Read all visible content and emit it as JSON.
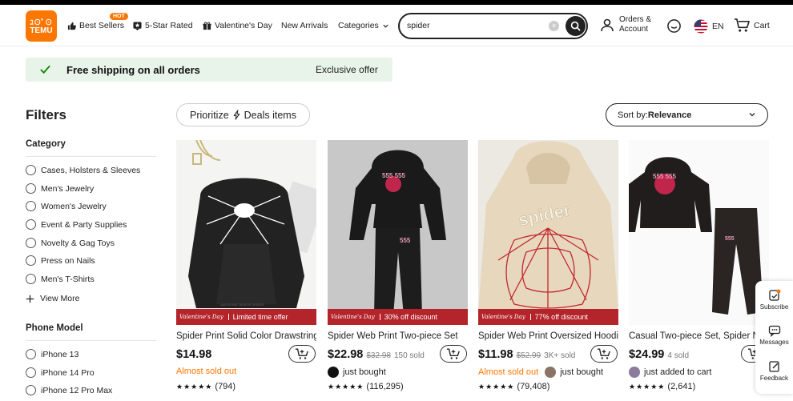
{
  "header": {
    "logo": {
      "line1": "ﾕ⊙ﾟ⊙",
      "line2": "TEMU"
    },
    "nav": {
      "best_sellers": "Best Sellers",
      "hot_badge": "HOT",
      "five_star": "5-Star Rated",
      "valentines": "Valentine's Day",
      "new_arrivals": "New Arrivals",
      "categories": "Categories"
    },
    "search": {
      "value": "spider"
    },
    "account": {
      "line1": "Orders &",
      "line2": "Account"
    },
    "language": "EN",
    "cart": "Cart"
  },
  "promo": {
    "text": "Free shipping on all orders",
    "offer": "Exclusive offer"
  },
  "filters": {
    "title": "Filters",
    "category": {
      "title": "Category",
      "options": [
        "Cases, Holsters & Sleeves",
        "Men's Jewelry",
        "Women's Jewelry",
        "Event & Party Supplies",
        "Novelty & Gag Toys",
        "Press on Nails",
        "Men's T-Shirts"
      ],
      "view_more": "View More"
    },
    "phone_model": {
      "title": "Phone Model",
      "options": [
        "iPhone 13",
        "iPhone 14 Pro",
        "iPhone 12 Pro Max"
      ]
    }
  },
  "toolbar": {
    "prioritize_prefix": "Prioritize",
    "prioritize_label": "Deals items",
    "sort_prefix": "Sort by: ",
    "sort_value": "Relevance"
  },
  "products": [
    {
      "banner_tag": "Valentine's Day",
      "banner": "Limited time offer",
      "title": "Spider Print Solid Color Drawstring Hoodie",
      "price": "$14.98",
      "was": "",
      "sold": "",
      "alert": "Almost sold out",
      "activity": "",
      "rating": "(794)",
      "stars": "★★★★★"
    },
    {
      "banner_tag": "Valentine's Day",
      "banner": "30% off discount",
      "title": "Spider Web Print Two-piece Set",
      "price": "$22.98",
      "was": "$32.98",
      "sold": "150 sold",
      "alert": "",
      "activity": "just bought",
      "rating": "(116,295)",
      "stars": "★★★★★"
    },
    {
      "banner_tag": "Valentine's Day",
      "banner": "77% off discount",
      "title": "Spider Web Print Oversized Hoodie",
      "price": "$11.98",
      "was": "$52.99",
      "sold": "3K+ sold",
      "alert": "Almost sold out",
      "activity": "just bought",
      "rating": "(79,408)",
      "stars": "★★★★★"
    },
    {
      "banner_tag": "",
      "banner": "",
      "title": "Casual Two-piece Set, Spider N",
      "price": "$24.99",
      "was": "",
      "sold": "4 sold",
      "alert": "",
      "activity": "just added to cart",
      "rating": "(2,641)",
      "stars": "★★★★★"
    }
  ],
  "side_widget": {
    "subscribe": "Subscribe",
    "messages": "Messages",
    "feedback": "Feedback"
  },
  "colors": {
    "brand": "#fb7701",
    "promo_bg": "#e8f4e9",
    "banner": "#b4252b"
  }
}
